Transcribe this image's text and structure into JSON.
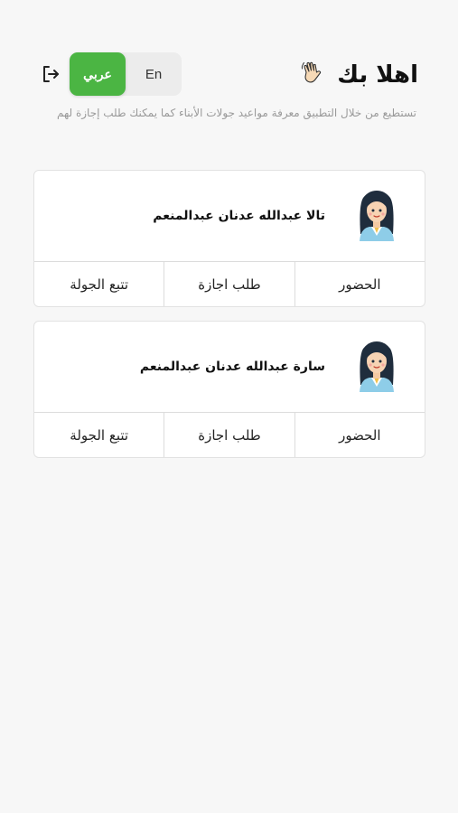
{
  "header": {
    "greeting": "اهلا بك",
    "subtitle": "تستطيع من خلال التطبيق معرفة مواعيد جولات الأبناء كما يمكنك طلب إجازة لهم",
    "lang": {
      "arabic_label": "عربي",
      "english_label": "En",
      "selected": "عربي"
    }
  },
  "colors": {
    "accent": "#4bb543",
    "background": "#f7f7f7"
  },
  "children": [
    {
      "name": "تالا عبدالله عدنان عبدالمنعم",
      "actions": {
        "track": "تتبع الجولة",
        "leave": "طلب اجازة",
        "attendance": "الحضور"
      }
    },
    {
      "name": "سارة عبدالله عدنان عبدالمنعم",
      "actions": {
        "track": "تتبع الجولة",
        "leave": "طلب اجازة",
        "attendance": "الحضور"
      }
    }
  ]
}
